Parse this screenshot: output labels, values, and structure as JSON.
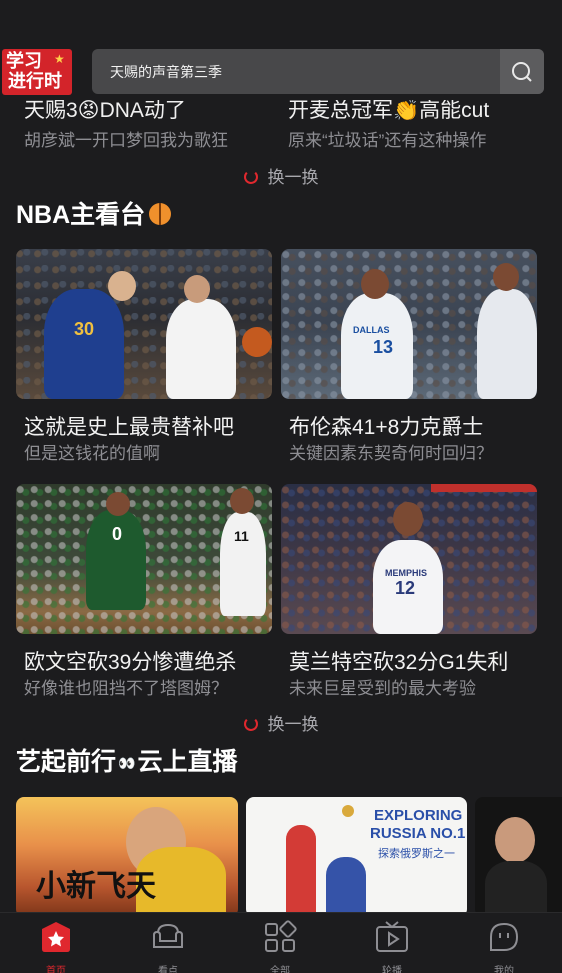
{
  "header": {
    "logo_line1": "学习",
    "logo_line2": "进行时",
    "search_text": "天赐的声音第三季"
  },
  "prev_section": {
    "items": [
      {
        "title": "天赐3😡DNA动了",
        "subtitle": "胡彦斌一开口梦回我为歌狂"
      },
      {
        "title": "开麦总冠军👏高能cut",
        "subtitle": "原来“垃圾话”还有这种操作"
      }
    ],
    "refresh_label": "换一换"
  },
  "nba": {
    "title": "NBA主看台",
    "cards": [
      {
        "title": "这就是史上最贵替补吧",
        "subtitle": "但是这钱花的值啊"
      },
      {
        "title": "布伦森41+8力克爵士",
        "subtitle": "关键因素东契奇何时回归？"
      },
      {
        "title": "欧文空砍39分惨遭绝杀",
        "subtitle": "好像谁也阻挡不了塔图姆？"
      },
      {
        "title": "莫兰特空砍32分G1失利",
        "subtitle": "未来巨星受到的最大考验"
      }
    ],
    "jerseys": [
      "30",
      "13",
      "0",
      "11",
      "12"
    ],
    "jersey_text": [
      "DALLAS",
      "MEMPHIS"
    ],
    "refresh_label": "换一换"
  },
  "live": {
    "title": "艺起前行",
    "title_suffix": "云上直播",
    "card1_text": "小新飞天",
    "card2_title_line1": "EXPLORING",
    "card2_title_line2": "RUSSIA NO.1",
    "card2_subtitle": "探索俄罗斯之一"
  },
  "tabbar": {
    "tabs": [
      {
        "label": "首页",
        "icon": "home-star-icon",
        "active": true
      },
      {
        "label": "看点",
        "icon": "sofa-icon",
        "active": false
      },
      {
        "label": "全部",
        "icon": "grid-icon",
        "active": false
      },
      {
        "label": "轮播",
        "icon": "tv-play-icon",
        "active": false
      },
      {
        "label": "我的",
        "icon": "profile-icon",
        "active": false
      }
    ]
  },
  "colors": {
    "accent": "#e0282e",
    "background": "#1c1c1e",
    "muted_text": "#8e8e93"
  }
}
